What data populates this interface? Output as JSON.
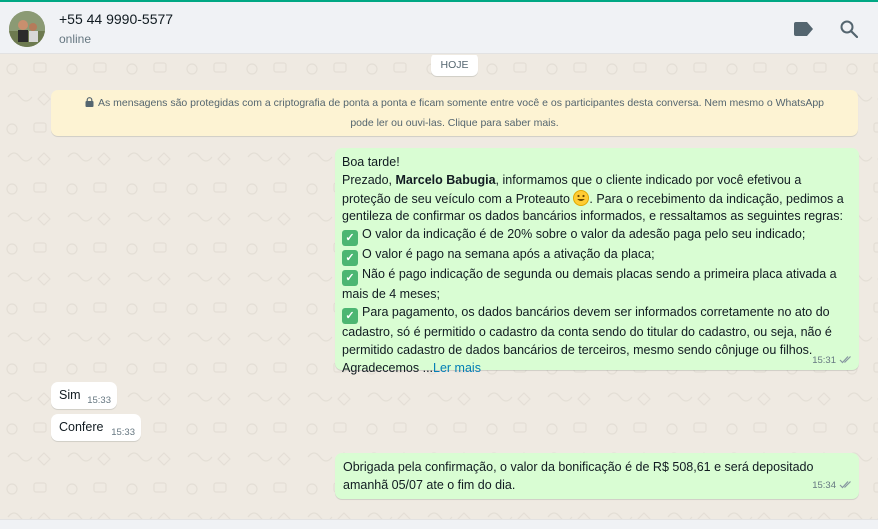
{
  "header": {
    "contact_name": "+55 44 9990-5577",
    "status": "online",
    "icons": [
      "label-icon",
      "search-icon"
    ]
  },
  "chat": {
    "date_divider": "HOJE",
    "encryption_notice": {
      "line1": "As mensagens são protegidas com a criptografia de ponta a ponta e ficam somente entre você e os participantes desta conversa. Nem mesmo o WhatsApp",
      "line2": "pode ler ou ouvi-las. Clique para saber mais."
    },
    "messages": [
      {
        "direction": "outgoing",
        "lines": {
          "l1": "Boa tarde!",
          "l2_pre": "Prezado, ",
          "l2_bold": "Marcelo Babugia",
          "l2_post": ", informamos que o cliente indicado por você efetivou a",
          "l3_pre": "proteção de seu veículo com a Proteauto ",
          "l3_post": ". Para o recebimento da indicação, pedimos a",
          "l4": "gentileza de confirmar os dados bancários informados, e  ressaltamos as seguintes regras:",
          "l5": "O valor da indicação é de 20% sobre o valor da adesão paga pelo seu indicado;",
          "l6": "O valor é pago na semana após a ativação da placa;",
          "l7": "Não é pago indicação de segunda ou demais placas sendo a primeira placa ativada a",
          "l8": "mais de 4 meses;",
          "l9": "Para pagamento, os dados bancários devem ser informados corretamente no ato do",
          "l10": "cadastro, só é permitido o cadastro da conta sendo do titular do cadastro, ou seja, não é",
          "l11": "permitido cadastro de dados bancários de terceiros, mesmo sendo cônjuge ou filhos.",
          "l12": "Agradecemos ..."
        },
        "read_more": "Ler mais",
        "time": "15:31",
        "status": "delivered"
      },
      {
        "direction": "incoming",
        "text": "Sim",
        "time": "15:33"
      },
      {
        "direction": "incoming",
        "text": "Confere",
        "time": "15:33"
      },
      {
        "direction": "outgoing",
        "line1": "Obrigada pela confirmação, o valor da bonificação é de R$ 508,61 e será depositado",
        "line2": "amanhã 05/07 ate o fim do dia.",
        "time": "15:34",
        "status": "delivered"
      }
    ]
  },
  "colors": {
    "accent": "#00a884",
    "outgoing_bubble": "#d9fdd3",
    "incoming_bubble": "#ffffff",
    "chat_background": "#efeae2",
    "notice_background": "#fdf3d3",
    "link": "#027eb5"
  }
}
